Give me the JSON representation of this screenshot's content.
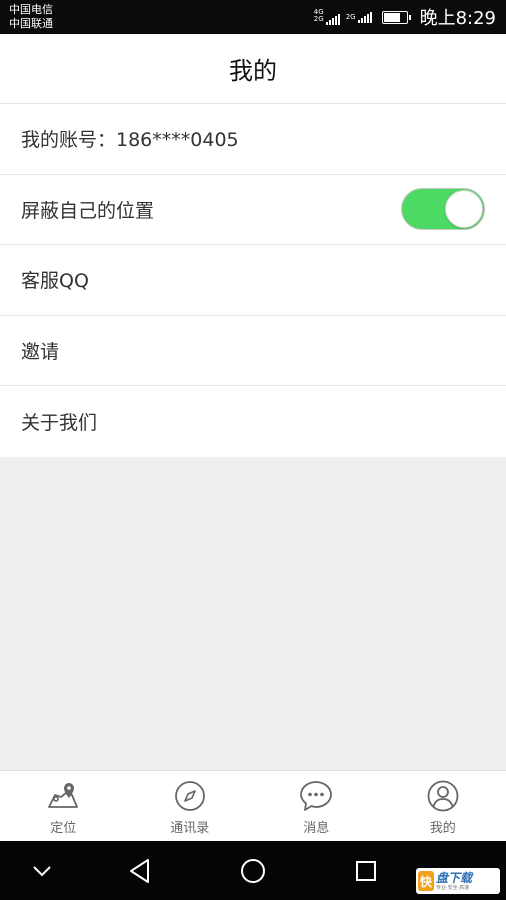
{
  "status_bar": {
    "carrier_1": "中国电信",
    "carrier_2": "中国联通",
    "network_1": "4G",
    "network_1b": "2G",
    "network_2": "2G",
    "battery_level": 0.8,
    "time": "晚上8:29"
  },
  "header": {
    "title": "我的"
  },
  "settings": [
    {
      "label": "我的账号：186****0405"
    },
    {
      "label": "屏蔽自己的位置",
      "toggle_on": true,
      "toggle_color": "#4cd964"
    },
    {
      "label": "客服QQ"
    },
    {
      "label": "邀请"
    },
    {
      "label": "关于我们"
    }
  ],
  "bottom_nav": [
    {
      "label": "定位",
      "icon": "map-pin-icon"
    },
    {
      "label": "通讯录",
      "icon": "compass-icon"
    },
    {
      "label": "消息",
      "icon": "chat-bubble-icon"
    },
    {
      "label": "我的",
      "icon": "user-icon"
    }
  ],
  "system_nav": {
    "buttons": [
      "chevron-down-icon",
      "back-triangle-icon",
      "home-circle-icon",
      "recents-square-icon"
    ]
  },
  "watermark": {
    "logo_char": "快",
    "main": "盘下载",
    "sub": "专业·安全·高速"
  }
}
